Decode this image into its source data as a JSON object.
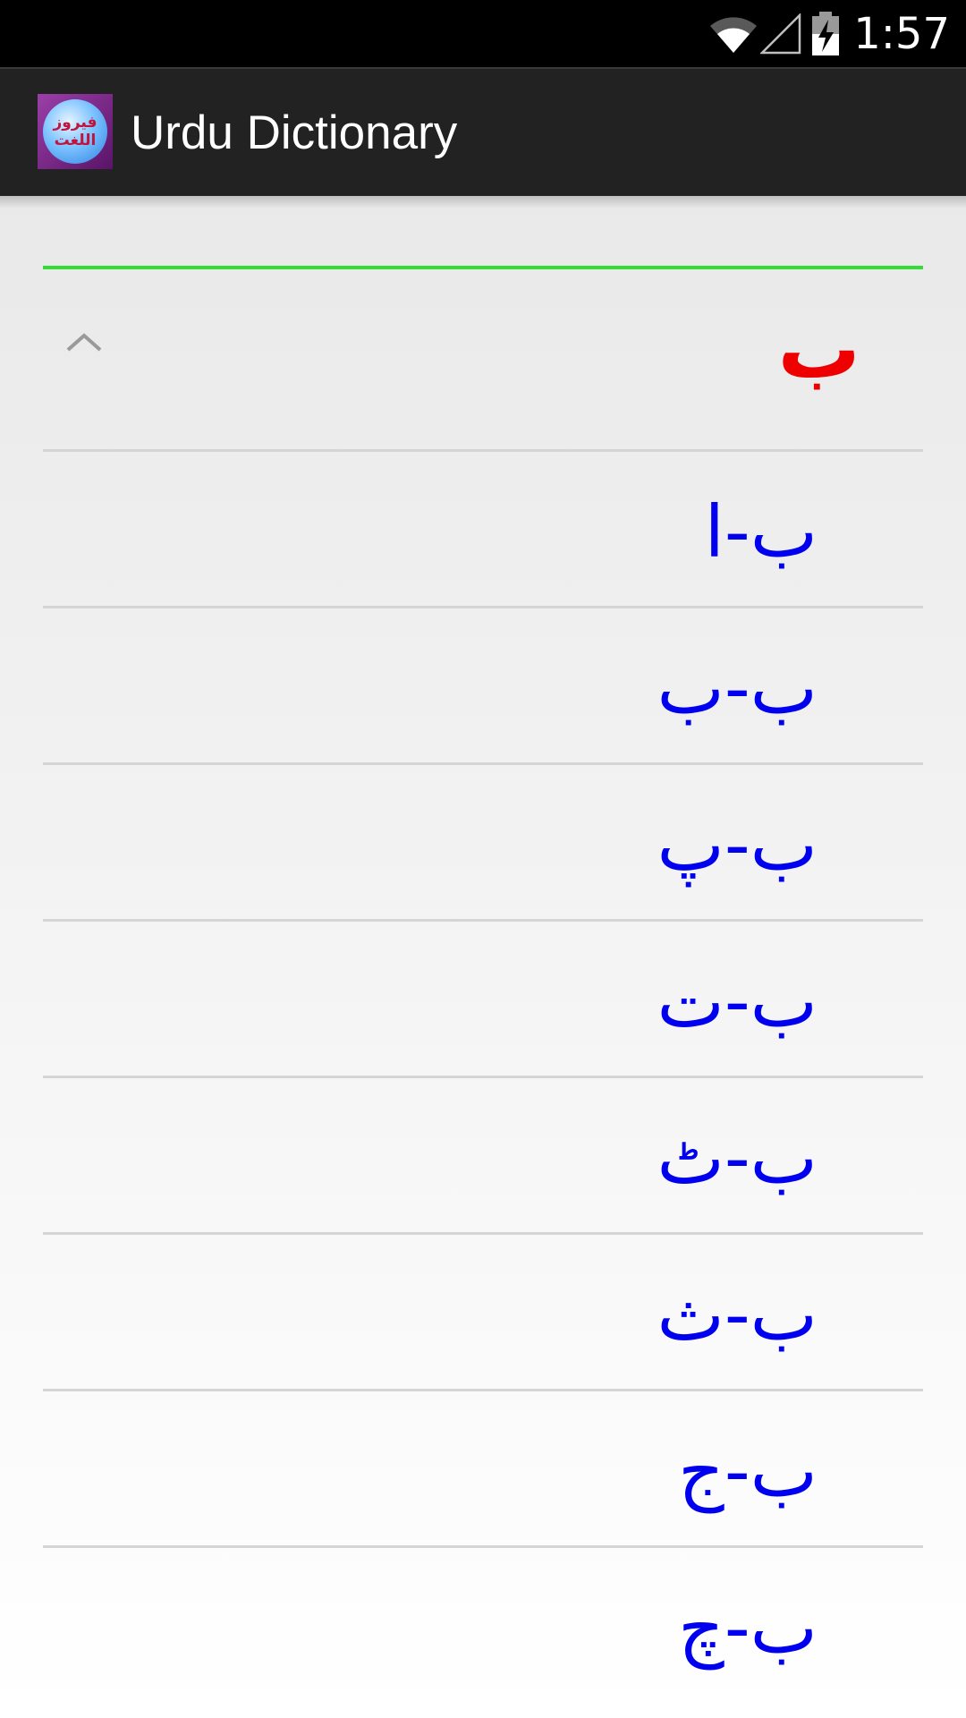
{
  "status_bar": {
    "time": "1:57",
    "icons": [
      "wifi-icon",
      "signal-icon",
      "battery-charging-icon"
    ]
  },
  "action_bar": {
    "app_icon_text_line1": "فیروز",
    "app_icon_text_line2": "اللغت",
    "title": "Urdu Dictionary"
  },
  "colors": {
    "header_letter": "#ee0000",
    "item_text": "#0000ee",
    "accent_line": "#33dd33",
    "action_bar_bg": "#222222"
  },
  "group": {
    "letter": "ب",
    "expanded": true,
    "collapse_icon": "chevron-up-icon"
  },
  "items": [
    {
      "label": "ب-ا"
    },
    {
      "label": "ب-ب"
    },
    {
      "label": "ب-پ"
    },
    {
      "label": "ب-ت"
    },
    {
      "label": "ب-ٹ"
    },
    {
      "label": "ب-ث"
    },
    {
      "label": "ب-ج"
    },
    {
      "label": "ب-چ"
    }
  ]
}
